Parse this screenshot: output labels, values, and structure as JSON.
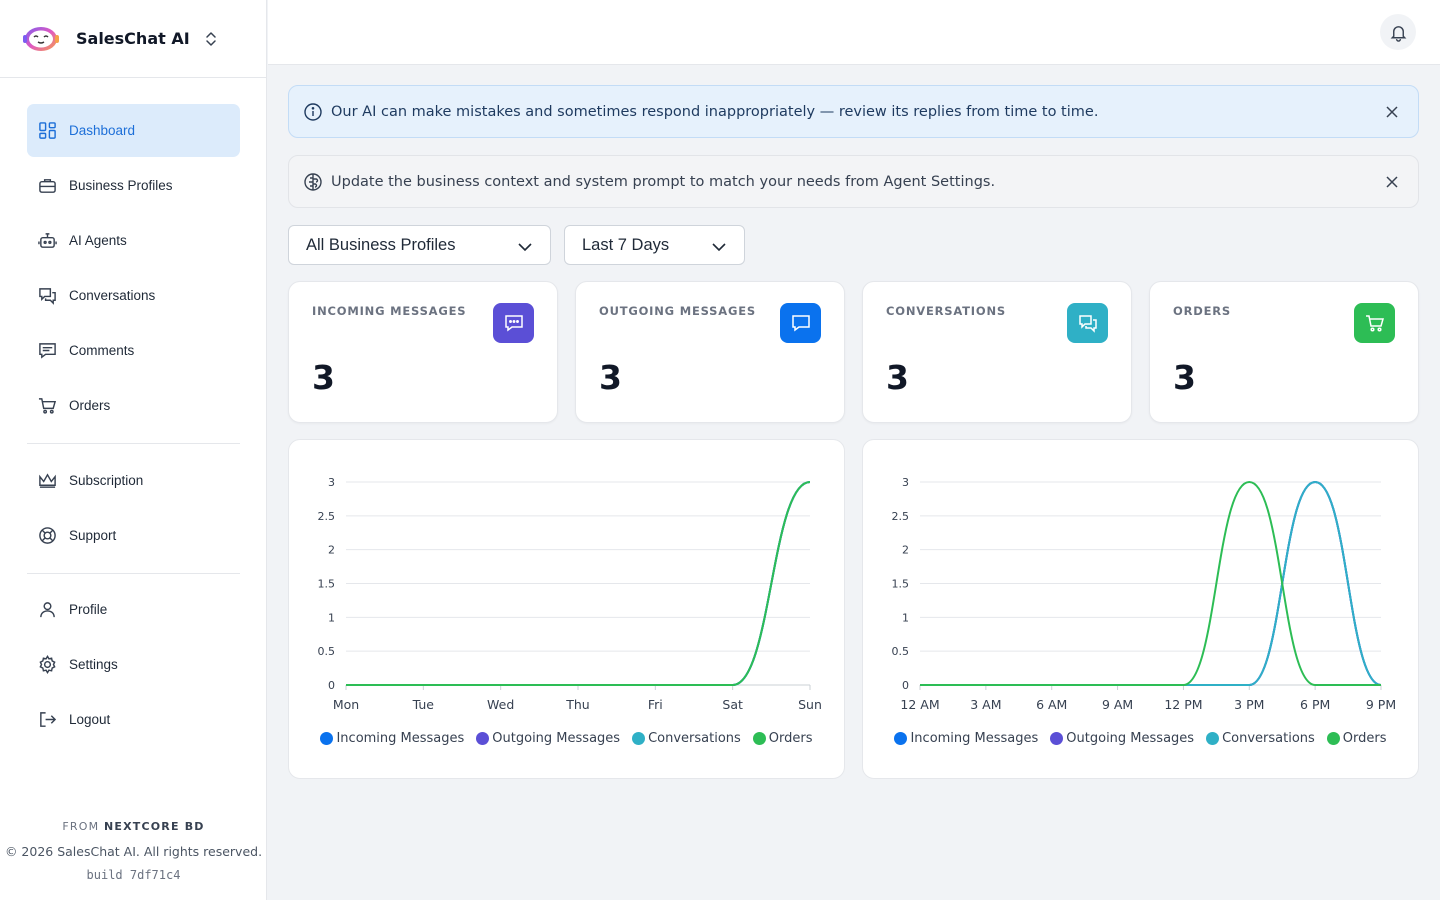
{
  "brand": {
    "name": "SalesChat AI"
  },
  "nav": {
    "primary": [
      {
        "label": "Dashboard",
        "icon": "dashboard-icon",
        "active": true
      },
      {
        "label": "Business Profiles",
        "icon": "briefcase-icon"
      },
      {
        "label": "AI Agents",
        "icon": "bot-icon"
      },
      {
        "label": "Conversations",
        "icon": "chats-icon"
      },
      {
        "label": "Comments",
        "icon": "comment-icon"
      },
      {
        "label": "Orders",
        "icon": "cart-icon"
      }
    ],
    "secondary": [
      {
        "label": "Subscription",
        "icon": "crown-icon"
      },
      {
        "label": "Support",
        "icon": "lifebuoy-icon"
      }
    ],
    "account": [
      {
        "label": "Profile",
        "icon": "user-icon"
      },
      {
        "label": "Settings",
        "icon": "gear-icon"
      },
      {
        "label": "Logout",
        "icon": "logout-icon"
      }
    ]
  },
  "footer": {
    "from_prefix": "FROM",
    "from_company": "NEXTCORE BD",
    "copyright": "© 2026 SalesChat AI. All rights reserved.",
    "build": "build 7df71c4"
  },
  "alerts": {
    "ai_warning": "Our AI can make mistakes and sometimes respond inappropriately — review its replies from time to time.",
    "context_tip": "Update the business context and system prompt to match your needs from Agent Settings."
  },
  "filters": {
    "profile": "All Business Profiles",
    "range": "Last 7 Days"
  },
  "stats": [
    {
      "label": "INCOMING MESSAGES",
      "value": "3",
      "color": "#5b4fd6",
      "icon": "message-dots-icon"
    },
    {
      "label": "OUTGOING MESSAGES",
      "value": "3",
      "color": "#0a72ee",
      "icon": "message-square-icon"
    },
    {
      "label": "CONVERSATIONS",
      "value": "3",
      "color": "#2fb0c6",
      "icon": "chats-icon"
    },
    {
      "label": "ORDERS",
      "value": "3",
      "color": "#2dbd55",
      "icon": "cart-icon"
    }
  ],
  "legend_colors": {
    "Incoming Messages": "#0a72ee",
    "Outgoing Messages": "#5b4fd6",
    "Conversations": "#2fb0c6",
    "Orders": "#2dbd55"
  },
  "chart_data": [
    {
      "type": "line",
      "x": [
        "Mon",
        "Tue",
        "Wed",
        "Thu",
        "Fri",
        "Sat",
        "Sun"
      ],
      "yticks": [
        "0",
        "0.5",
        "1",
        "1.5",
        "2",
        "2.5",
        "3"
      ],
      "ylim": [
        0,
        3
      ],
      "grid": true,
      "legend_position": "bottom",
      "series": [
        {
          "name": "Incoming Messages",
          "values": [
            0,
            0,
            0,
            0,
            0,
            0,
            3
          ]
        },
        {
          "name": "Outgoing Messages",
          "values": [
            0,
            0,
            0,
            0,
            0,
            0,
            3
          ]
        },
        {
          "name": "Conversations",
          "values": [
            0,
            0,
            0,
            0,
            0,
            0,
            3
          ]
        },
        {
          "name": "Orders",
          "values": [
            0,
            0,
            0,
            0,
            0,
            0,
            3
          ]
        }
      ]
    },
    {
      "type": "line",
      "x": [
        "12 AM",
        "3 AM",
        "6 AM",
        "9 AM",
        "12 PM",
        "3 PM",
        "6 PM",
        "9 PM"
      ],
      "yticks": [
        "0",
        "0.5",
        "1",
        "1.5",
        "2",
        "2.5",
        "3"
      ],
      "ylim": [
        0,
        3
      ],
      "grid": true,
      "legend_position": "bottom",
      "series": [
        {
          "name": "Incoming Messages",
          "values": [
            0,
            0,
            0,
            0,
            0,
            0,
            3,
            0
          ]
        },
        {
          "name": "Outgoing Messages",
          "values": [
            0,
            0,
            0,
            0,
            0,
            0,
            3,
            0
          ]
        },
        {
          "name": "Conversations",
          "values": [
            0,
            0,
            0,
            0,
            0,
            0,
            3,
            0
          ]
        },
        {
          "name": "Orders",
          "values": [
            0,
            0,
            0,
            0,
            0,
            3,
            0,
            0
          ]
        }
      ]
    }
  ]
}
